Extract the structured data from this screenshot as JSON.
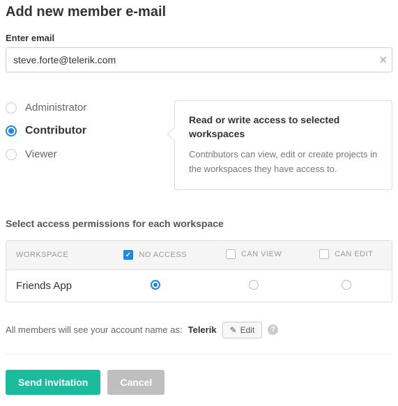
{
  "title": "Add new member e-mail",
  "emailField": {
    "label": "Enter email",
    "value": "steve.forte@telerik.com"
  },
  "roles": {
    "items": [
      {
        "key": "administrator",
        "label": "Administrator",
        "selected": false
      },
      {
        "key": "contributor",
        "label": "Contributor",
        "selected": true
      },
      {
        "key": "viewer",
        "label": "Viewer",
        "selected": false
      }
    ],
    "description": {
      "title": "Read or write access to selected workspaces",
      "body": "Contributors can view, edit or create projects in the workspaces they have access to."
    }
  },
  "permissions": {
    "heading": "Select access permissions for each workspace",
    "columns": {
      "workspace": "WORKSPACE",
      "noAccess": {
        "label": "NO ACCESS",
        "checked": true
      },
      "canView": {
        "label": "CAN VIEW",
        "checked": false
      },
      "canEdit": {
        "label": "CAN EDIT",
        "checked": false
      }
    },
    "rows": [
      {
        "name": "Friends App",
        "value": "noAccess"
      }
    ]
  },
  "account": {
    "prefix": "All members will see your account name as:",
    "name": "Telerik",
    "editLabel": "Edit"
  },
  "actions": {
    "submit": "Send invitation",
    "cancel": "Cancel"
  }
}
